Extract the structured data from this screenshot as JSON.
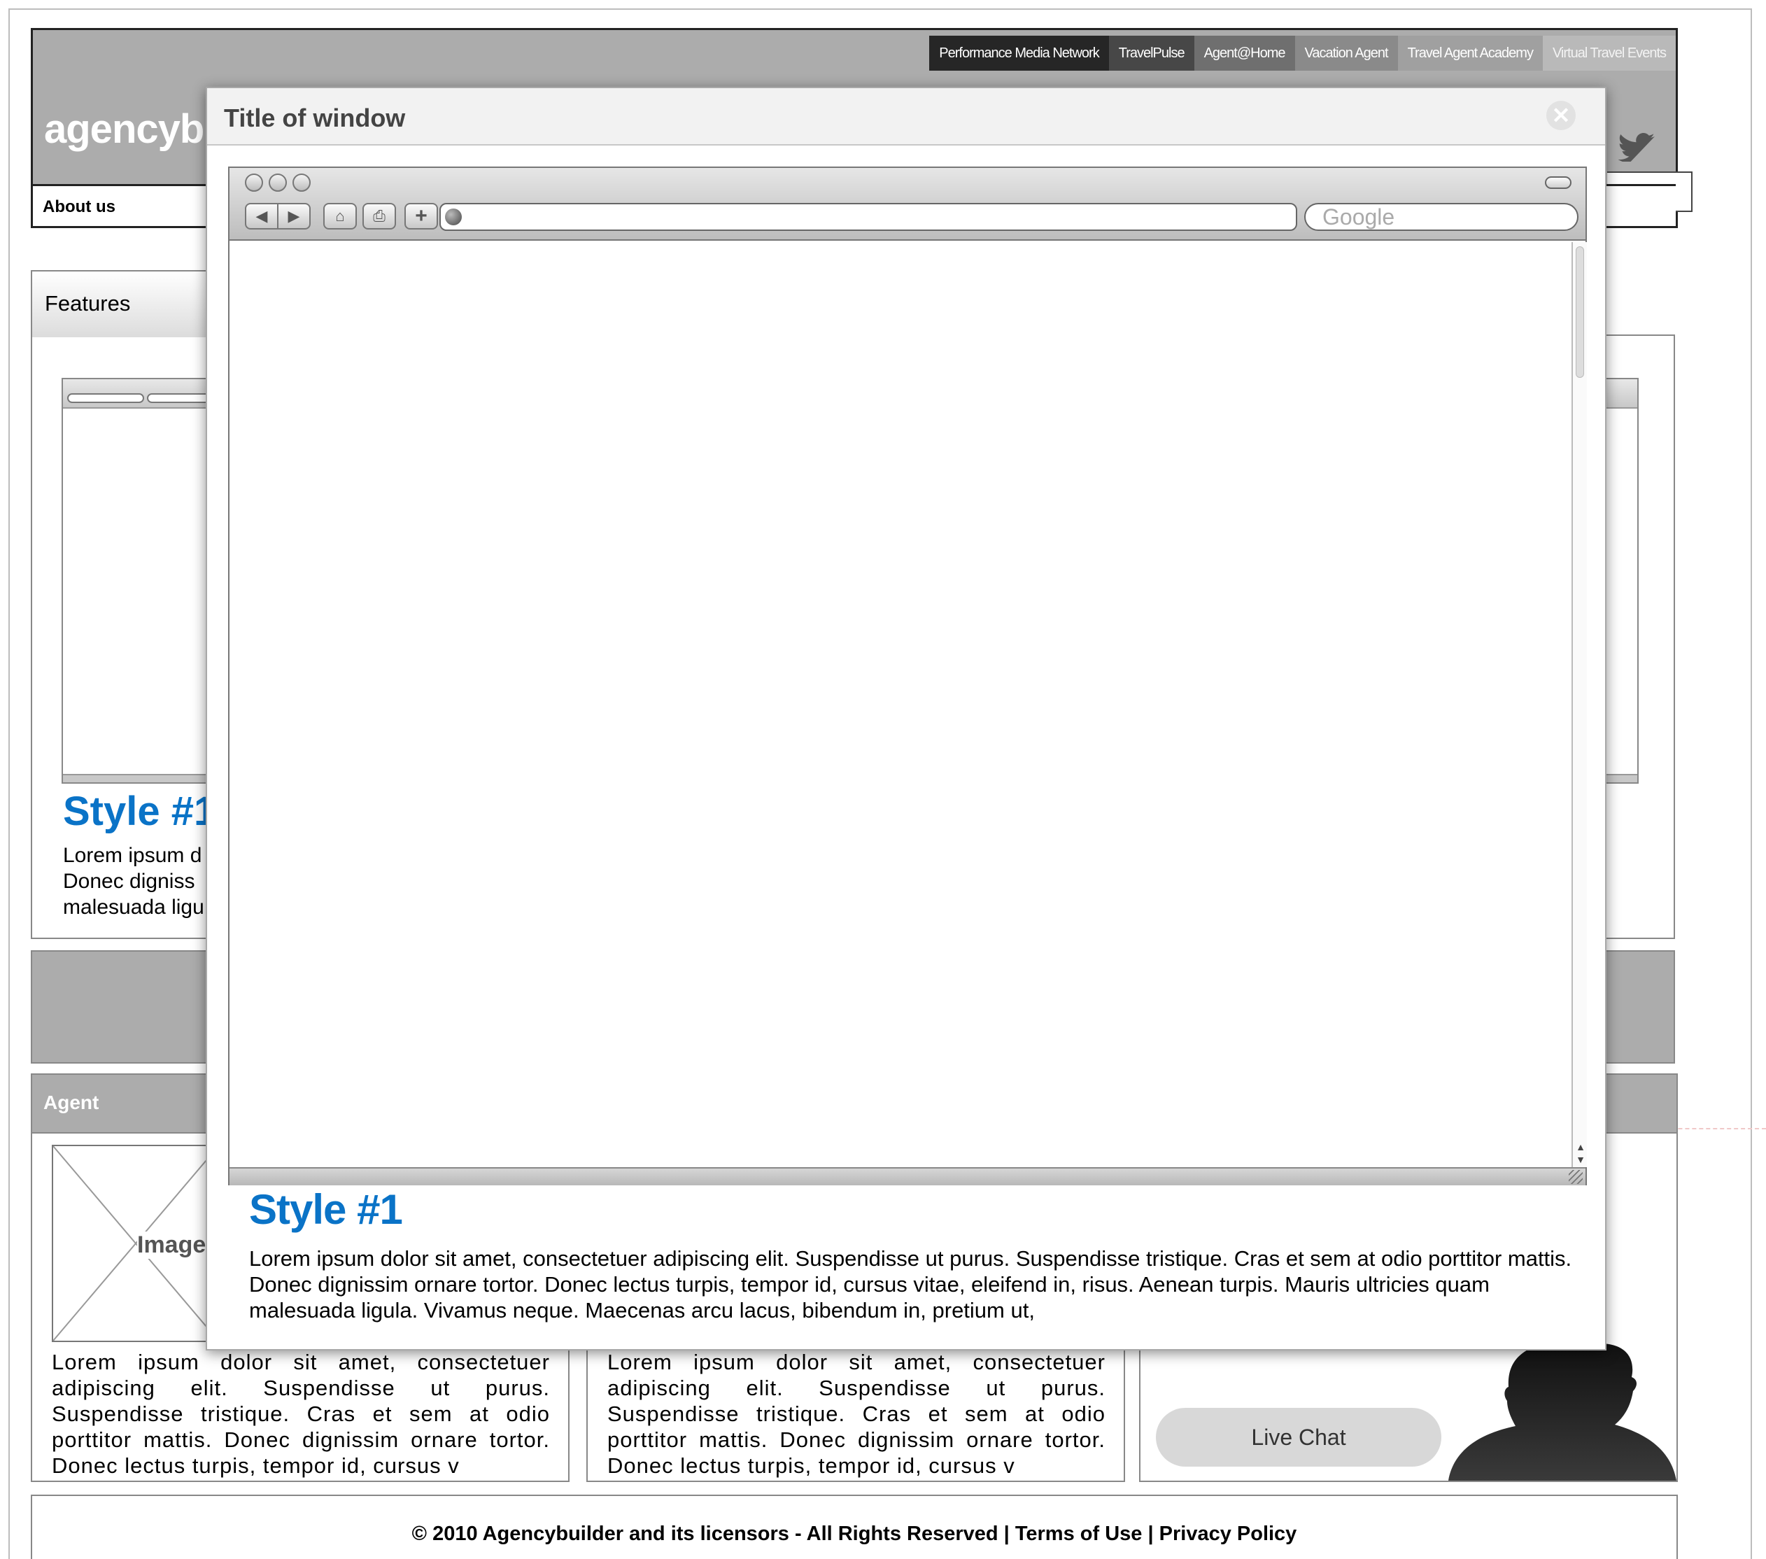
{
  "header": {
    "logo": "agencybu",
    "top_nav": [
      "Performance Media Network",
      "TravelPulse",
      "Agent@Home",
      "Vacation Agent",
      "Travel Agent Academy",
      "Virtual Travel Events"
    ],
    "main_nav": {
      "about": "About us"
    }
  },
  "features": {
    "tab_label": "Features",
    "style_title": "Style #1",
    "lines": [
      "Lorem ipsum d",
      "Donec  digniss",
      "malesuada ligu"
    ]
  },
  "agent": {
    "section_label": "Agent",
    "image_placeholder": "Image",
    "col1_text": "Lorem ipsum dolor sit amet, consectetuer adipiscing elit. Suspendisse ut purus. Suspendisse tristique. Cras et sem at odio porttitor mattis. Donec dignissim ornare tortor. Donec lectus turpis, tempor id, cursus v",
    "col2_text": "Lorem ipsum dolor sit amet, consectetuer adipiscing elit. Suspendisse ut purus. Suspendisse tristique. Cras et sem at odio porttitor mattis. Donec dignissim ornare tortor. Donec lectus turpis, tempor id, cursus v",
    "live_chat": "Live Chat"
  },
  "footer": {
    "copyright": "© 2010 Agencybuilder and its licensors - All Rights Reserved  | Terms of Use | Privacy Policy"
  },
  "modal": {
    "title": "Title of window",
    "close_icon": "close-icon",
    "browser": {
      "search_placeholder": "Google"
    },
    "style_title": "Style #1",
    "body": "Lorem ipsum dolor sit amet, consectetuer adipiscing elit. Suspendisse ut purus. Suspendisse tristique. Cras et sem at odio porttitor mattis. Donec dignissim ornare tortor. Donec lectus turpis, tempor id, cursus vitae, eleifend in, risus. Aenean turpis. Mauris ultricies quam malesuada ligula. Vivamus neque. Maecenas arcu lacus, bibendum in, pretium ut,"
  },
  "colors": {
    "accent_blue": "#0a73c7",
    "header_grey": "#acacac",
    "nav_dark": "#262626"
  }
}
